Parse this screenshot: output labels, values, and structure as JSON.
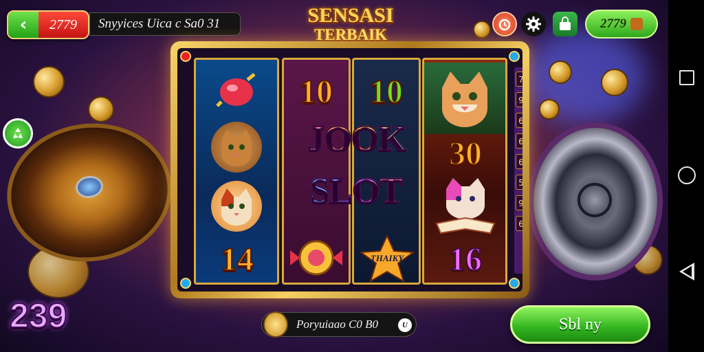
{
  "header": {
    "back_value": "2779",
    "marquee_text": "Snyyices Uica c Sa0 31",
    "title_line1": "SENSASI",
    "title_line2": "TERBAIK",
    "balance": "2779"
  },
  "reels": {
    "reel2_top": "10",
    "reel3_top": "10",
    "center_line1": "JOOK",
    "center_line2": "SLOT",
    "reel4_num": "30",
    "reel1_bottom": "14",
    "reel3_badge": "THAIKY",
    "reel4_bottom": "16"
  },
  "side_pips": [
    "7",
    "9",
    "6",
    "6",
    "6",
    "5",
    "9",
    "6"
  ],
  "footer": {
    "score": "239",
    "promo_text": "Poryuiaao C0 B0",
    "promo_icon": "U",
    "spin_label": "Sbl ny"
  },
  "colors": {
    "accent_gold": "#f7d46a",
    "spin_green": "#31b41f",
    "back_red": "#c41414"
  }
}
